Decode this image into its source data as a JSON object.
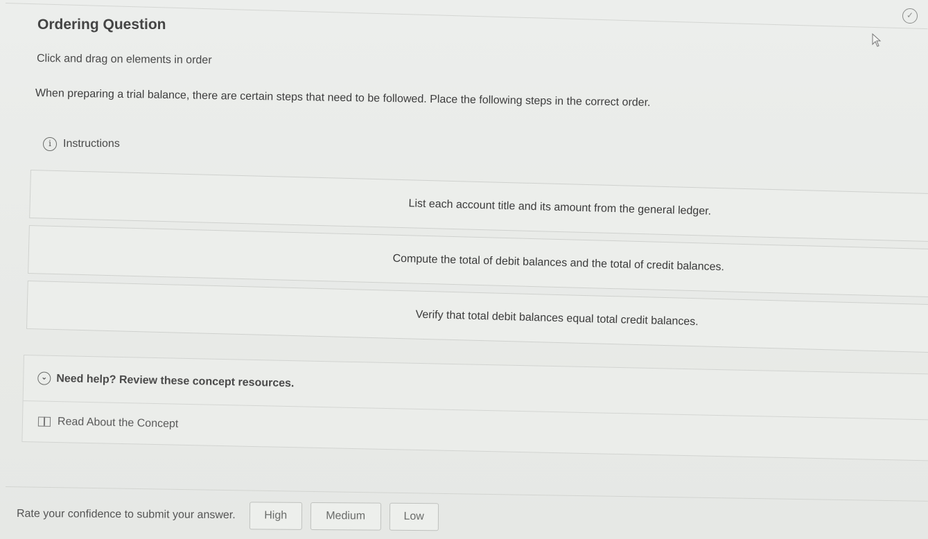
{
  "header": {
    "title": "Ordering Question",
    "prompt": "Click and drag on elements in order",
    "question": "When preparing a trial balance, there are certain steps that need to be followed. Place the following steps in the correct order.",
    "instructions_label": "Instructions"
  },
  "items": [
    {
      "text": "List each account title and its amount from the general ledger."
    },
    {
      "text": "Compute the total of debit balances and the total of credit balances."
    },
    {
      "text": "Verify that total debit balances equal total credit balances."
    }
  ],
  "help": {
    "header": "Need help? Review these concept resources.",
    "link": "Read About the Concept"
  },
  "confidence": {
    "label": "Rate your confidence to submit your answer.",
    "buttons": [
      "High",
      "Medium",
      "Low"
    ]
  },
  "icons": [
    "check-circle-icon",
    "cursor-icon",
    "info-icon",
    "chevron-down-icon",
    "book-icon"
  ]
}
